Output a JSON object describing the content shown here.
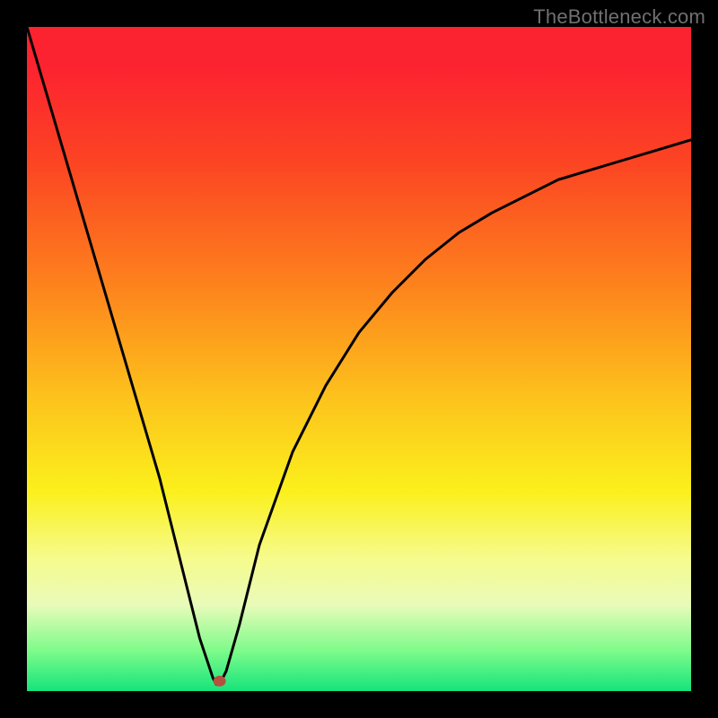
{
  "attribution": "TheBottleneck.com",
  "chart_data": {
    "type": "line",
    "title": "",
    "xlabel": "",
    "ylabel": "",
    "xlim": [
      0,
      1
    ],
    "ylim": [
      0,
      1
    ],
    "series": [
      {
        "name": "bottleneck-curve",
        "x": [
          0.0,
          0.05,
          0.1,
          0.15,
          0.2,
          0.24,
          0.26,
          0.28,
          0.285,
          0.29,
          0.3,
          0.32,
          0.35,
          0.4,
          0.45,
          0.5,
          0.55,
          0.6,
          0.65,
          0.7,
          0.75,
          0.8,
          0.85,
          0.9,
          0.95,
          1.0
        ],
        "y": [
          1.0,
          0.83,
          0.66,
          0.49,
          0.32,
          0.16,
          0.08,
          0.02,
          0.01,
          0.01,
          0.03,
          0.1,
          0.22,
          0.36,
          0.46,
          0.54,
          0.6,
          0.65,
          0.69,
          0.72,
          0.745,
          0.77,
          0.785,
          0.8,
          0.815,
          0.83
        ]
      }
    ],
    "marker": {
      "x": 0.29,
      "y": 0.015
    },
    "background_gradient": {
      "direction": "vertical",
      "stops": [
        {
          "pos": 0.0,
          "color": "#fc2330"
        },
        {
          "pos": 0.2,
          "color": "#fc4323"
        },
        {
          "pos": 0.38,
          "color": "#fd7f1d"
        },
        {
          "pos": 0.56,
          "color": "#fdc31c"
        },
        {
          "pos": 0.7,
          "color": "#fbf01c"
        },
        {
          "pos": 0.87,
          "color": "#e9fbb9"
        },
        {
          "pos": 1.0,
          "color": "#15e47c"
        }
      ]
    }
  }
}
